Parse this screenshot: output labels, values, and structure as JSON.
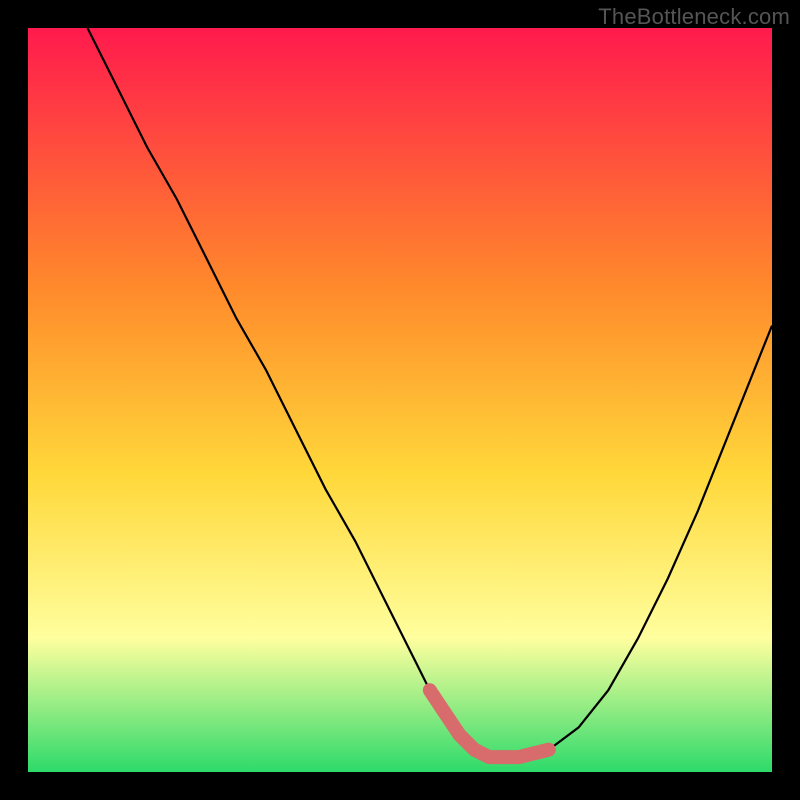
{
  "watermark": "TheBottleneck.com",
  "colors": {
    "bg": "#000000",
    "grad_top": "#ff1a4d",
    "grad_mid1": "#ff8a2b",
    "grad_mid2": "#ffd83a",
    "grad_mid3": "#ffff9e",
    "grad_bottom": "#2dda6a",
    "curve": "#000000",
    "marker": "#d86b6b"
  },
  "chart_data": {
    "type": "line",
    "title": "",
    "xlabel": "",
    "ylabel": "",
    "xlim": [
      0,
      100
    ],
    "ylim": [
      0,
      100
    ],
    "x": [
      8,
      12,
      16,
      20,
      24,
      28,
      32,
      36,
      40,
      44,
      48,
      52,
      54,
      56,
      58,
      60,
      62,
      64,
      66,
      70,
      74,
      78,
      82,
      86,
      90,
      94,
      98,
      100
    ],
    "y": [
      100,
      92,
      84,
      77,
      69,
      61,
      54,
      46,
      38,
      31,
      23,
      15,
      11,
      8,
      5,
      3,
      2,
      2,
      2,
      3,
      6,
      11,
      18,
      26,
      35,
      45,
      55,
      60
    ],
    "markers": {
      "x": [
        54,
        56,
        58,
        60,
        62,
        64,
        66,
        70
      ],
      "y": [
        11,
        8,
        5,
        3,
        2,
        2,
        2,
        3
      ]
    }
  }
}
